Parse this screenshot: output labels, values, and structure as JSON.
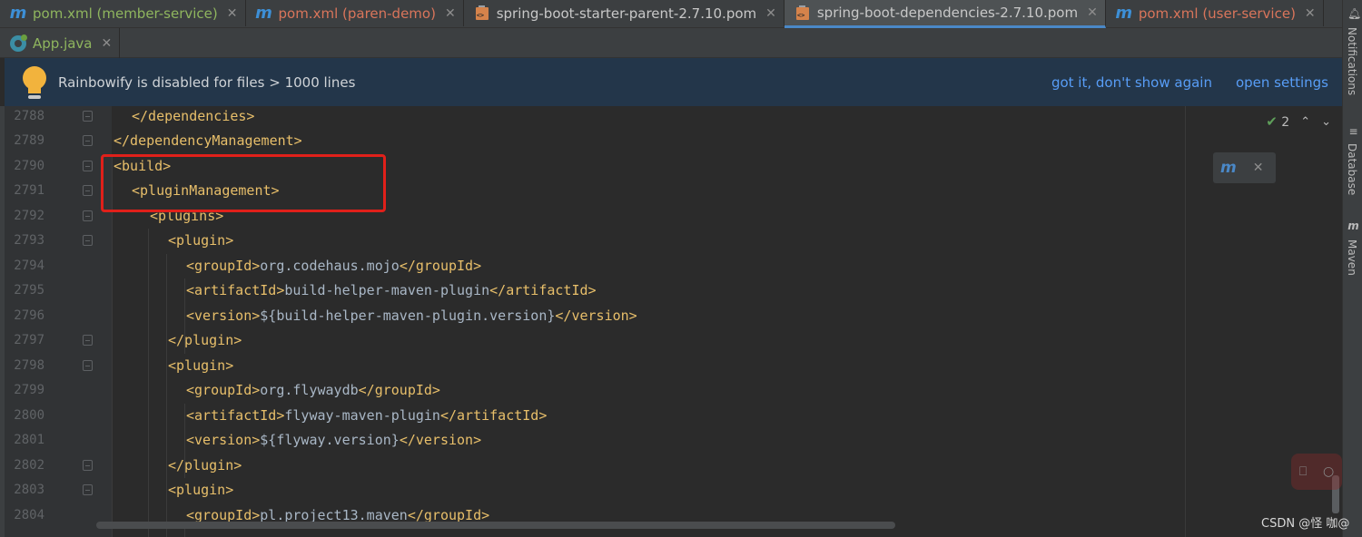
{
  "tabs_row1": [
    {
      "label": "pom.xml (member-service)",
      "icon": "maven-icon",
      "color": "green",
      "active": false
    },
    {
      "label": "pom.xml (paren-demo)",
      "icon": "maven-icon",
      "color": "red",
      "active": false
    },
    {
      "label": "spring-boot-starter-parent-2.7.10.pom",
      "icon": "pom-file-icon",
      "color": "plain",
      "active": false
    },
    {
      "label": "spring-boot-dependencies-2.7.10.pom",
      "icon": "pom-file-icon",
      "color": "plain",
      "active": true
    },
    {
      "label": "pom.xml (user-service)",
      "icon": "maven-icon",
      "color": "red",
      "active": false
    }
  ],
  "tabs_row2": [
    {
      "label": "App.java",
      "icon": "java-class-icon",
      "color": "green",
      "active": false
    }
  ],
  "tab_close_glyph": "✕",
  "banner": {
    "message": "Rainbowify is disabled for files > 1000 lines",
    "link_dismiss": "got it, don't show again",
    "link_settings": "open settings"
  },
  "editor": {
    "lines": [
      {
        "num": "2788",
        "indent": 2,
        "tag": "</dependencies>",
        "text": "",
        "close": "",
        "fold": true
      },
      {
        "num": "2789",
        "indent": 1,
        "tag": "</dependencyManagement>",
        "text": "",
        "close": "",
        "fold": true
      },
      {
        "num": "2790",
        "indent": 1,
        "tag": "<build>",
        "text": "",
        "close": "",
        "fold": true
      },
      {
        "num": "2791",
        "indent": 2,
        "tag": "<pluginManagement>",
        "text": "",
        "close": "",
        "fold": true
      },
      {
        "num": "2792",
        "indent": 3,
        "tag": "<plugins>",
        "text": "",
        "close": "",
        "fold": true
      },
      {
        "num": "2793",
        "indent": 4,
        "tag": "<plugin>",
        "text": "",
        "close": "",
        "fold": true
      },
      {
        "num": "2794",
        "indent": 5,
        "tag": "<groupId>",
        "text": "org.codehaus.mojo",
        "close": "</groupId>",
        "fold": false
      },
      {
        "num": "2795",
        "indent": 5,
        "tag": "<artifactId>",
        "text": "build-helper-maven-plugin",
        "close": "</artifactId>",
        "fold": false
      },
      {
        "num": "2796",
        "indent": 5,
        "tag": "<version>",
        "text": "${build-helper-maven-plugin.version}",
        "close": "</version>",
        "fold": false
      },
      {
        "num": "2797",
        "indent": 4,
        "tag": "</plugin>",
        "text": "",
        "close": "",
        "fold": true
      },
      {
        "num": "2798",
        "indent": 4,
        "tag": "<plugin>",
        "text": "",
        "close": "",
        "fold": true
      },
      {
        "num": "2799",
        "indent": 5,
        "tag": "<groupId>",
        "text": "org.flywaydb",
        "close": "</groupId>",
        "fold": false
      },
      {
        "num": "2800",
        "indent": 5,
        "tag": "<artifactId>",
        "text": "flyway-maven-plugin",
        "close": "</artifactId>",
        "fold": false
      },
      {
        "num": "2801",
        "indent": 5,
        "tag": "<version>",
        "text": "${flyway.version}",
        "close": "</version>",
        "fold": false
      },
      {
        "num": "2802",
        "indent": 4,
        "tag": "</plugin>",
        "text": "",
        "close": "",
        "fold": true
      },
      {
        "num": "2803",
        "indent": 4,
        "tag": "<plugin>",
        "text": "",
        "close": "",
        "fold": true
      },
      {
        "num": "2804",
        "indent": 5,
        "tag": "<groupId>",
        "text": "pl.project13.maven",
        "close": "</groupId>",
        "fold": false
      }
    ]
  },
  "inspection": {
    "count": "2",
    "check_glyph": "✔",
    "up_glyph": "⌃",
    "down_glyph": "⌄"
  },
  "maven_popup": {
    "icon_text": "m",
    "close_glyph": "✕"
  },
  "tool_windows": [
    {
      "label": "Notifications",
      "icon": "bell-icon"
    },
    {
      "label": "Database",
      "icon": "database-icon"
    },
    {
      "label": "Maven",
      "icon": "maven-icon"
    }
  ],
  "watermark": "CSDN @怪 咖@",
  "colors": {
    "tag": "#e8bf6a",
    "text": "#a9b7c6",
    "link": "#589df6",
    "highlight": "#e0201a",
    "banner_bg": "#23364a"
  }
}
